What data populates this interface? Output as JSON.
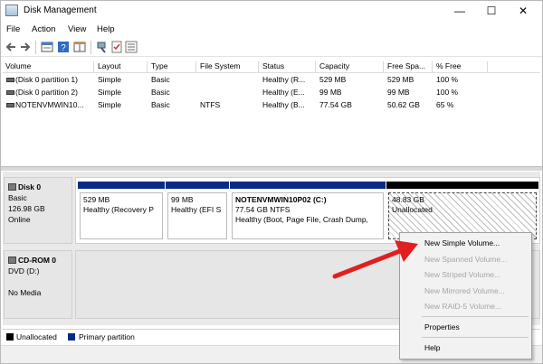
{
  "window": {
    "title": "Disk Management",
    "controls": {
      "minimize": "—",
      "maximize": "☐",
      "close": "✕"
    }
  },
  "menu": [
    "File",
    "Action",
    "View",
    "Help"
  ],
  "toolbar": {
    "icons": [
      "back-icon",
      "forward-icon",
      "properties-icon",
      "help-icon",
      "tile-icon",
      "connect-icon",
      "check-icon",
      "list-icon"
    ]
  },
  "volume_list": {
    "columns": [
      "Volume",
      "Layout",
      "Type",
      "File System",
      "Status",
      "Capacity",
      "Free Spa...",
      "% Free"
    ],
    "rows": [
      {
        "volume": "(Disk 0 partition 1)",
        "layout": "Simple",
        "type": "Basic",
        "fs": "",
        "status": "Healthy (R...",
        "capacity": "529 MB",
        "free": "529 MB",
        "pct": "100 %"
      },
      {
        "volume": "(Disk 0 partition 2)",
        "layout": "Simple",
        "type": "Basic",
        "fs": "",
        "status": "Healthy (E...",
        "capacity": "99 MB",
        "free": "99 MB",
        "pct": "100 %"
      },
      {
        "volume": "NOTENVMWIN10...",
        "layout": "Simple",
        "type": "Basic",
        "fs": "NTFS",
        "status": "Healthy (B...",
        "capacity": "77.54 GB",
        "free": "50.62 GB",
        "pct": "65 %"
      }
    ]
  },
  "disk0": {
    "name": "Disk 0",
    "type": "Basic",
    "size": "126.98 GB",
    "state": "Online",
    "partitions": [
      {
        "title": "",
        "line1": "529 MB",
        "line2": "Healthy (Recovery P"
      },
      {
        "title": "",
        "line1": "99 MB",
        "line2": "Healthy (EFI S"
      },
      {
        "title": "NOTENVMWIN10P02  (C:)",
        "line1": "77.54 GB NTFS",
        "line2": "Healthy (Boot, Page File, Crash Dump,"
      },
      {
        "title": "",
        "line1": "48.83 GB",
        "line2": "Unallocated"
      }
    ]
  },
  "cdrom0": {
    "name": "CD-ROM 0",
    "drive": "DVD (D:)",
    "media": "No Media"
  },
  "legend": [
    {
      "label": "Unallocated",
      "color": "#000000"
    },
    {
      "label": "Primary partition",
      "color": "#0b2a86"
    }
  ],
  "context_menu": {
    "items": [
      {
        "label": "New Simple Volume...",
        "enabled": true
      },
      {
        "label": "New Spanned Volume...",
        "enabled": false
      },
      {
        "label": "New Striped Volume...",
        "enabled": false
      },
      {
        "label": "New Mirrored Volume...",
        "enabled": false
      },
      {
        "label": "New RAID-5 Volume...",
        "enabled": false
      },
      {
        "label": "Properties",
        "enabled": true
      },
      {
        "label": "Help",
        "enabled": true
      }
    ]
  },
  "colors": {
    "primary_partition": "#0b2a86",
    "annotation_arrow": "#e02020"
  }
}
